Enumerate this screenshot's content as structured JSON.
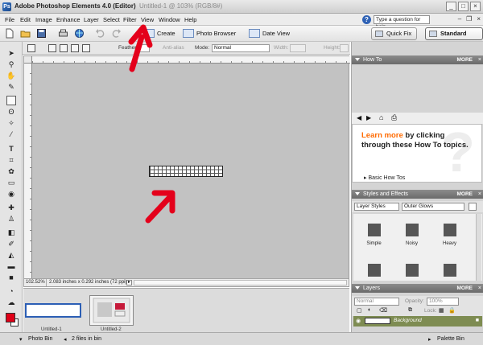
{
  "window": {
    "app_title": "Adobe Photoshop Elements 4.0 (Editor)",
    "doc_title": "Untitled-1 @ 103% (RGB/8#)",
    "min": "_",
    "max": "□",
    "close": "×"
  },
  "menu": [
    "File",
    "Edit",
    "Image",
    "Enhance",
    "Layer",
    "Select",
    "Filter",
    "View",
    "Window",
    "Help"
  ],
  "help_search": {
    "value": "Type a question for help"
  },
  "shortcuts": {
    "create": "Create",
    "photo_browser": "Photo Browser",
    "date_view": "Date View",
    "quick_fix": "Quick Fix",
    "standard_edit": "Standard Edit"
  },
  "options": {
    "feather_label": "Feather:",
    "anti_alias_label": "Anti-alias",
    "mode_label": "Mode:",
    "mode_value": "Normal",
    "width_label": "Width:",
    "height_label": "Height:"
  },
  "status": {
    "zoom": "102.52%",
    "doc_info": "2.083 inches x 0.292 inches (72 ppi)"
  },
  "photo_bin": {
    "thumb1_label": "Untitled-1",
    "thumb2_label": "Untitled-2"
  },
  "bottom": {
    "photo_bin_label": "Photo Bin",
    "files_label": "2 files in bin",
    "palette_bin_label": "Palette Bin"
  },
  "howto": {
    "title": "How To",
    "more": "MORE",
    "headline_accent": "Learn more",
    "headline_rest": " by clicking through these How To topics.",
    "link": "Basic How Tos"
  },
  "styles": {
    "title": "Styles and Effects",
    "more": "MORE",
    "category": "Layer Styles",
    "subcategory": "Outer Glows",
    "items": [
      "Simple",
      "Noisy",
      "Heavy"
    ]
  },
  "layers": {
    "title": "Layers",
    "more": "MORE",
    "blend": "Normal",
    "opacity_label": "Opacity:",
    "opacity_value": "100%",
    "lock_label": "Lock:",
    "layer_name": "Background"
  },
  "colors": {
    "foreground": "#e00017",
    "background": "#ffffff",
    "howto_accent": "#ff6a00",
    "annotation_arrow": "#e4001b"
  }
}
